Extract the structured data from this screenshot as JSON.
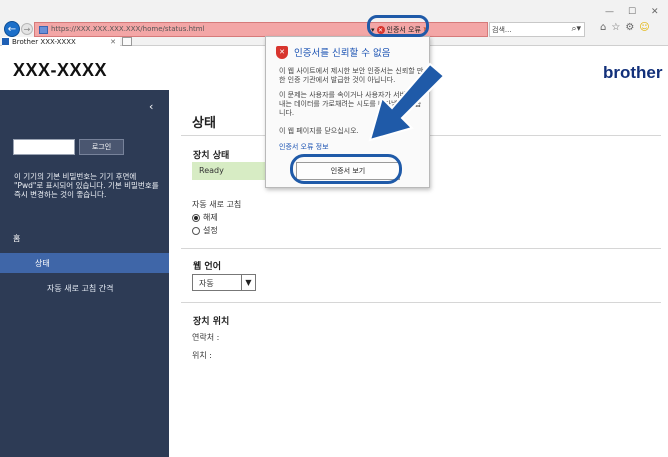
{
  "browser": {
    "url": "https://XXX.XXX.XXX.XXX/home/status.html",
    "cert_error_label": "인증서 오류",
    "search_placeholder": "검색...",
    "tab_title": "Brother XXX-XXXX"
  },
  "header": {
    "model_name": "XXX-XXXX",
    "brand": "brother"
  },
  "sidebar": {
    "login_button": "로그인",
    "password_notice": "이 기기의 기본 비밀번호는 기기 후면에 \"Pwd\"로 표시되어 있습니다. 기본 비밀번호를 즉시 변경하는 것이 좋습니다.",
    "nav_home": "홈",
    "nav_status": "상태",
    "nav_auto_refresh": "자동 새로 고침 간격"
  },
  "main": {
    "page_title": "상태",
    "device_status_title": "장치 상태",
    "device_status_value": "Ready",
    "auto_refresh_label": "자동 새로 고침",
    "auto_refresh_options": [
      "해제",
      "설정"
    ],
    "auto_refresh_selected": "해제",
    "web_language_title": "웹 언어",
    "language_value": "자동",
    "device_location_title": "장치 위치",
    "contact_label": "연락처 :",
    "location_label": "위치 :"
  },
  "cert_popup": {
    "title": "인증서를 신뢰할 수 없음",
    "text1": "이 웹 사이트에서 제시한 보안 인증서는 신뢰할 만한 인증 기관에서 발급한 것이 아닙니다.",
    "text2": "이 문제는 사용자를 속이거나 사용자가 서버로 보내는 데이터를 가로채려는 시도를 나타낼 수 있습니다.",
    "text3": "이 웹 페이지를 닫으십시오.",
    "error_info_link": "인증서 오류 정보",
    "view_button": "인증서 보기"
  },
  "colors": {
    "sidebar_bg": "#2d3b55",
    "nav_active": "#3f66a8",
    "address_error": "#f3a6a6",
    "status_ready": "#d7ecc4",
    "callout": "#1f5aa8"
  }
}
